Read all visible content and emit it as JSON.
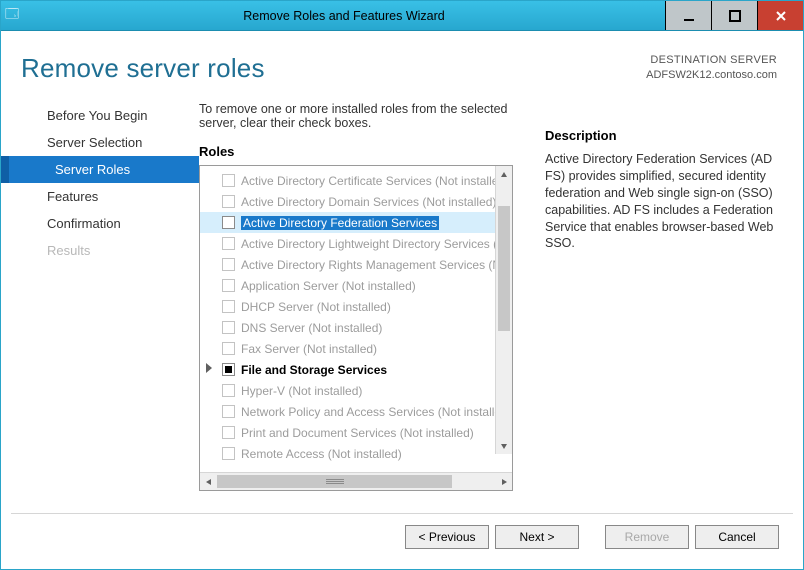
{
  "window": {
    "title": "Remove Roles and Features Wizard"
  },
  "header": {
    "title": "Remove server roles",
    "destination_label": "DESTINATION SERVER",
    "destination_server": "ADFSW2K12.contoso.com"
  },
  "sidebar": {
    "steps": [
      {
        "label": "Before You Begin",
        "state": "normal"
      },
      {
        "label": "Server Selection",
        "state": "normal"
      },
      {
        "label": "Server Roles",
        "state": "active"
      },
      {
        "label": "Features",
        "state": "normal"
      },
      {
        "label": "Confirmation",
        "state": "normal"
      },
      {
        "label": "Results",
        "state": "disabled"
      }
    ]
  },
  "main": {
    "instruction": "To remove one or more installed roles from the selected server, clear their check boxes.",
    "roles_title": "Roles",
    "roles": [
      {
        "label": "Active Directory Certificate Services (Not installed)",
        "status": "notinstalled"
      },
      {
        "label": "Active Directory Domain Services (Not installed)",
        "status": "notinstalled"
      },
      {
        "label": "Active Directory Federation Services",
        "status": "selected"
      },
      {
        "label": "Active Directory Lightweight Directory Services (Not installed)",
        "status": "notinstalled"
      },
      {
        "label": "Active Directory Rights Management Services (Not installed)",
        "status": "notinstalled"
      },
      {
        "label": "Application Server (Not installed)",
        "status": "notinstalled"
      },
      {
        "label": "DHCP Server (Not installed)",
        "status": "notinstalled"
      },
      {
        "label": "DNS Server (Not installed)",
        "status": "notinstalled"
      },
      {
        "label": "Fax Server (Not installed)",
        "status": "notinstalled"
      },
      {
        "label": "File and Storage Services",
        "status": "partial",
        "expandable": true
      },
      {
        "label": "Hyper-V (Not installed)",
        "status": "notinstalled"
      },
      {
        "label": "Network Policy and Access Services (Not installed)",
        "status": "notinstalled"
      },
      {
        "label": "Print and Document Services (Not installed)",
        "status": "notinstalled"
      },
      {
        "label": "Remote Access (Not installed)",
        "status": "notinstalled"
      }
    ]
  },
  "description": {
    "title": "Description",
    "text": "Active Directory Federation Services (AD FS) provides simplified, secured identity federation and Web single sign-on (SSO) capabilities. AD FS includes a Federation Service that enables browser-based Web SSO."
  },
  "footer": {
    "previous": "< Previous",
    "next": "Next >",
    "remove": "Remove",
    "cancel": "Cancel"
  }
}
